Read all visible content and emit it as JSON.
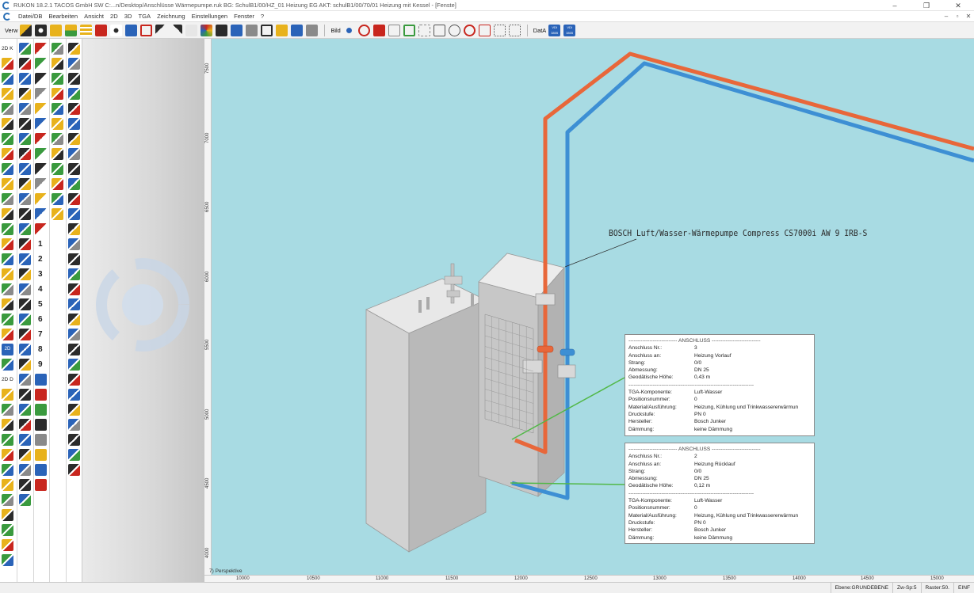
{
  "titlebar": {
    "title": "RUKON 18.2.1 TACOS GmbH SW   C:...n/Desktop/Anschlüsse Wärmepumpe.ruk  BG: SchulB1/00/HZ_01 Heizung EG  AKT: schulB1/00/70/01 Heizung mit Kessel - [Fenste]",
    "controls": [
      "–",
      "❐",
      "✕"
    ]
  },
  "menubar": {
    "items": [
      "Datei/DB",
      "Bearbeiten",
      "Ansicht",
      "2D",
      "3D",
      "TGA",
      "Zeichnung",
      "Einstellungen",
      "Fenster",
      "?"
    ],
    "window_controls": [
      "–",
      "▫",
      "✕"
    ]
  },
  "toolbar": {
    "verw_label": "Verw",
    "bild_label": "Bild",
    "data_label": "DatA",
    "vdi_label_1": "VDI 3805",
    "vdi_label_2": "VDI 3805",
    "colors": {
      "yellow": "#e8b21c",
      "blue": "#2a63b8",
      "red": "#c8261e",
      "dark": "#2b2b2b",
      "green": "#3a9a3e",
      "grey": "#8a8a8a"
    }
  },
  "sidebar": {
    "label_2dk": "2D K",
    "label_2dd": "2D D",
    "label_2d_tile": "2D",
    "step_labels": [
      "1",
      "2",
      "3",
      "4",
      "5",
      "6",
      "7",
      "8",
      "9"
    ]
  },
  "viewport": {
    "background": "#a8dbe3",
    "view_label": "7) Perspektive",
    "y_ticks": [
      "7500",
      "7000",
      "6500",
      "6000",
      "5500",
      "5000",
      "4500",
      "4000"
    ],
    "x_ticks": [
      "10000",
      "10500",
      "11000",
      "11500",
      "12000",
      "12500",
      "13000",
      "13500",
      "14000",
      "14500",
      "15000"
    ],
    "callout_text": "BOSCH Luft/Wasser-Wärmepumpe Compress CS7000i AW 9 IRB-S",
    "pipe_colors": {
      "supply": "#e8673a",
      "return": "#3d8fd4",
      "leader": "#52b848"
    }
  },
  "info_box_1": {
    "header": "---------------------------- ANSCHLUSS ----------------------------",
    "rows": [
      {
        "k": "Anschluss Nr.:",
        "v": "3"
      },
      {
        "k": "Anschluss an:",
        "v": "Heizung Vorlauf"
      },
      {
        "k": "Strang:",
        "v": "0/0"
      },
      {
        "k": "Abmessung:",
        "v": "DN 25"
      },
      {
        "k": "Geodätische Höhe:",
        "v": "0,43  m"
      }
    ],
    "divider": "------------------------------------------------------------------------",
    "rows2": [
      {
        "k": "TGA-Komponente:",
        "v": "Luft-Wasser"
      },
      {
        "k": "Positionsnummer:",
        "v": "0"
      },
      {
        "k": "Material/Ausführung:",
        "v": "Heizung, Kühlung und Trinkwassererwärmun"
      },
      {
        "k": "Druckstufe:",
        "v": "PN   0"
      },
      {
        "k": "Hersteller:",
        "v": "Bosch Junker"
      },
      {
        "k": "Dämmung:",
        "v": "keine Dämmung"
      }
    ]
  },
  "info_box_2": {
    "header": "---------------------------- ANSCHLUSS ----------------------------",
    "rows": [
      {
        "k": "Anschluss Nr.:",
        "v": "2"
      },
      {
        "k": "Anschluss an:",
        "v": "Heizung Rücklauf"
      },
      {
        "k": "Strang:",
        "v": "0/0"
      },
      {
        "k": "Abmessung:",
        "v": "DN 25"
      },
      {
        "k": "Geodätische Höhe:",
        "v": "0,12  m"
      }
    ],
    "divider": "------------------------------------------------------------------------",
    "rows2": [
      {
        "k": "TGA-Komponente:",
        "v": "Luft-Wasser"
      },
      {
        "k": "Positionsnummer:",
        "v": "0"
      },
      {
        "k": "Material/Ausführung:",
        "v": "Heizung, Kühlung und Trinkwassererwärmun"
      },
      {
        "k": "Druckstufe:",
        "v": "PN   0"
      },
      {
        "k": "Hersteller:",
        "v": "Bosch Junker"
      },
      {
        "k": "Dämmung:",
        "v": "keine Dämmung"
      }
    ]
  },
  "statusbar": {
    "ebene": "Ebene:GRUNDEBENE",
    "zwsp": "Zw-Sp:5",
    "raster": "Raster:50.",
    "ein": "EINF"
  }
}
